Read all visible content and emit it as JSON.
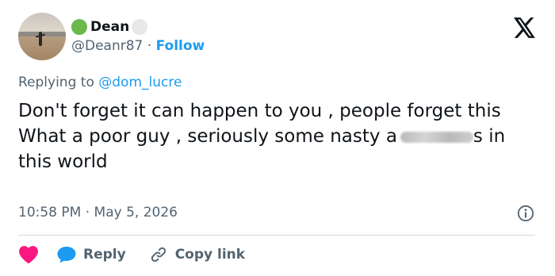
{
  "author": {
    "name": "Dean",
    "handle": "@Deanr87",
    "separator": "·",
    "follow_label": "Follow"
  },
  "replying": {
    "prefix": "Replying to",
    "mention": "@dom_lucre"
  },
  "tweet": {
    "line1": "Don't forget it can happen to you , people forget this",
    "line2_before": "What a poor guy , seriously some nasty a",
    "line2_after": "s in this world"
  },
  "timestamp": "10:58 PM · May 5, 2026",
  "actions": {
    "reply_label": "Reply",
    "copy_link_label": "Copy link"
  },
  "icons": {
    "brand": "x-logo-icon",
    "info": "info-icon",
    "like": "heart-icon",
    "reply": "reply-bubble-icon",
    "copy": "link-icon"
  },
  "colors": {
    "accent": "#1d9bf0",
    "like": "#f91880",
    "muted_text": "#536471",
    "body_text": "#0f1419"
  }
}
